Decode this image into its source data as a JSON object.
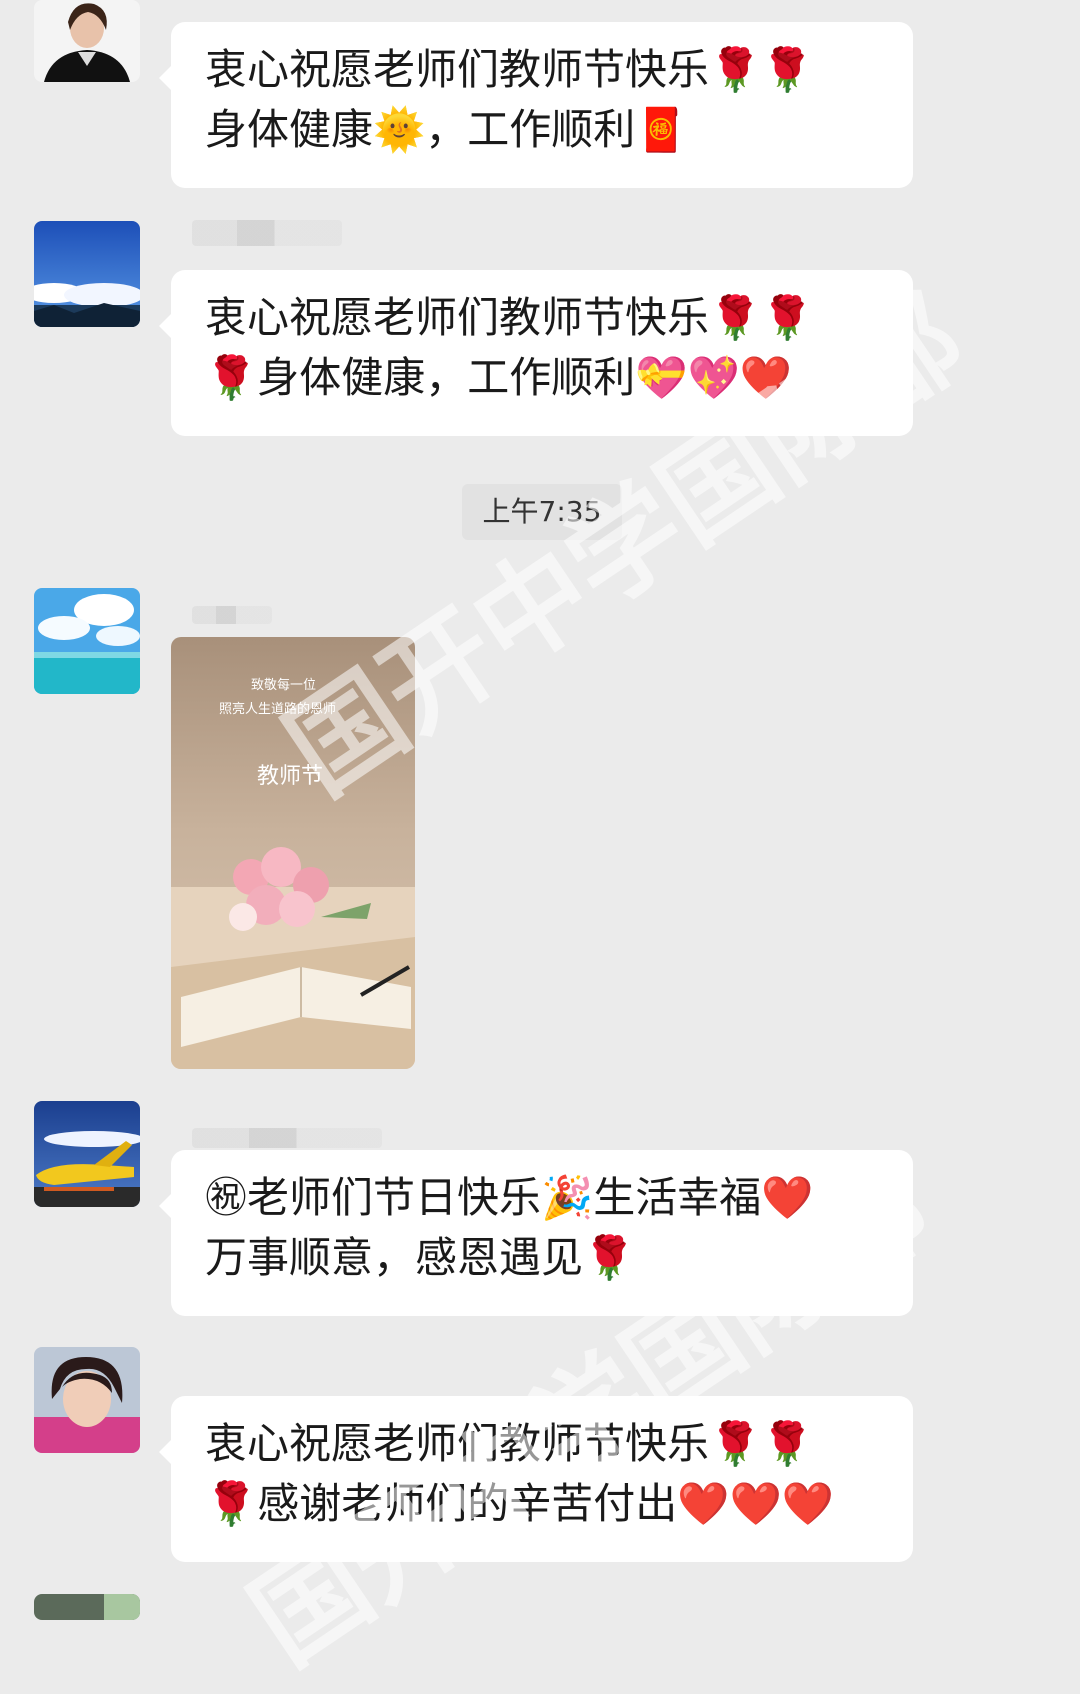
{
  "messages": [
    {
      "lines": [
        "衷心祝愿老师们教师节快乐🌹🌹",
        "身体健康🌞，工作顺利🧧"
      ]
    },
    {
      "lines": [
        "衷心祝愿老师们教师节快乐🌹🌹",
        "🌹身体健康，工作顺利💝💖❤️"
      ]
    },
    {
      "timestamp": "上午7:35"
    },
    {
      "image": {
        "heading": "致敬每一位",
        "subheading": "照亮人生道路的恩师",
        "caption": "教师节"
      }
    },
    {
      "lines": [
        "㊗老师们节日快乐🎉生活幸福❤️",
        "万事顺意，感恩遇见🌹"
      ]
    },
    {
      "lines": [
        "衷心祝愿老师们教师节快乐🌹🌹",
        "🌹感谢老师们的辛苦付出❤️❤️❤️"
      ]
    }
  ],
  "watermark": {
    "text_top": "国开中学国际部",
    "text_bottom": "国开中学国际部"
  },
  "colors": {
    "background": "#ebebeb",
    "bubble": "#ffffff",
    "text": "#1a1a1a"
  }
}
